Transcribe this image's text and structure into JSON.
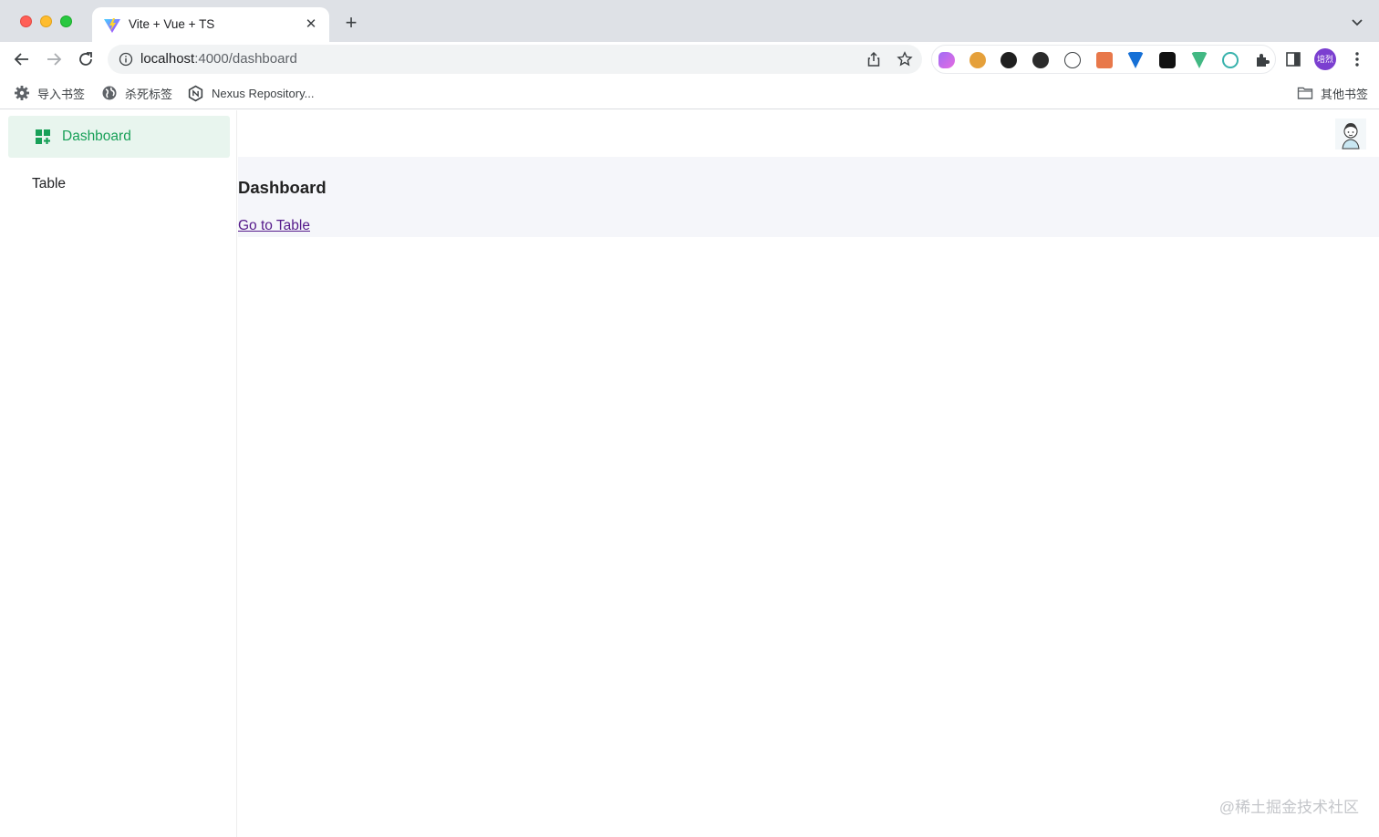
{
  "browser": {
    "tab": {
      "title": "Vite + Vue + TS"
    },
    "address": {
      "host": "localhost",
      "path": ":4000/dashboard"
    },
    "profile_initials": "培烈",
    "bookmarks": [
      {
        "label": "导入书签",
        "icon": "gear-icon"
      },
      {
        "label": "杀死标签",
        "icon": "globe-icon"
      },
      {
        "label": "Nexus Repository...",
        "icon": "nexus-icon"
      }
    ],
    "other_bookmarks": "其他书签"
  },
  "sidebar": {
    "items": [
      {
        "label": "Dashboard",
        "icon": "dashboard-icon",
        "active": true
      },
      {
        "label": "Table",
        "active": false
      }
    ]
  },
  "main": {
    "title": "Dashboard",
    "link": "Go to Table"
  },
  "watermark": "@稀土掘金技术社区",
  "colors": {
    "accent": "#18a058",
    "active_bg": "#e8f5ee",
    "content_bg": "#f5f6fa"
  }
}
